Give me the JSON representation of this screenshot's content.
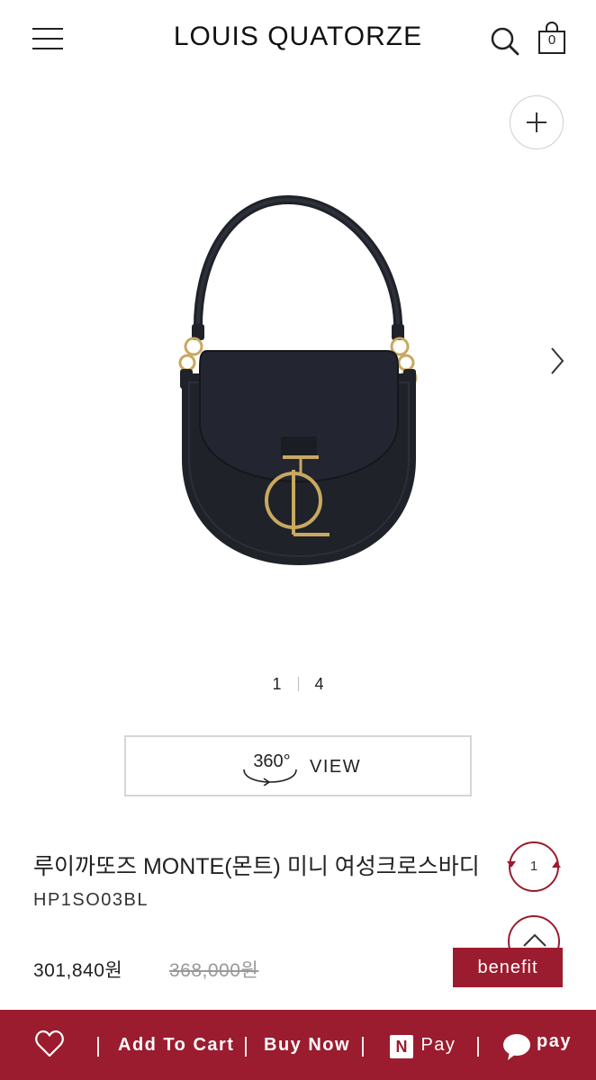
{
  "header": {
    "brand": "LOUIS QUATORZE",
    "cart_count": "0"
  },
  "gallery": {
    "current": "1",
    "total": "4"
  },
  "view360": {
    "icon_text": "360°",
    "label": "VIEW"
  },
  "product": {
    "name": "루이까또즈 MONTE(몬트) 미니 여성크로스바디",
    "code": "HP1SO03BL",
    "price": "301,840원",
    "original_price": "368,000원",
    "quantity": "1"
  },
  "actions": {
    "benefit_label": "benefit",
    "add_to_cart": "Add To Cart",
    "buy_now": "Buy Now",
    "npay_badge": "N",
    "npay_label": "Pay",
    "kakaopay_label": "pay"
  },
  "colors": {
    "accent": "#9b1c2e",
    "bag": "#1f2229",
    "hardware": "#c9a860"
  }
}
